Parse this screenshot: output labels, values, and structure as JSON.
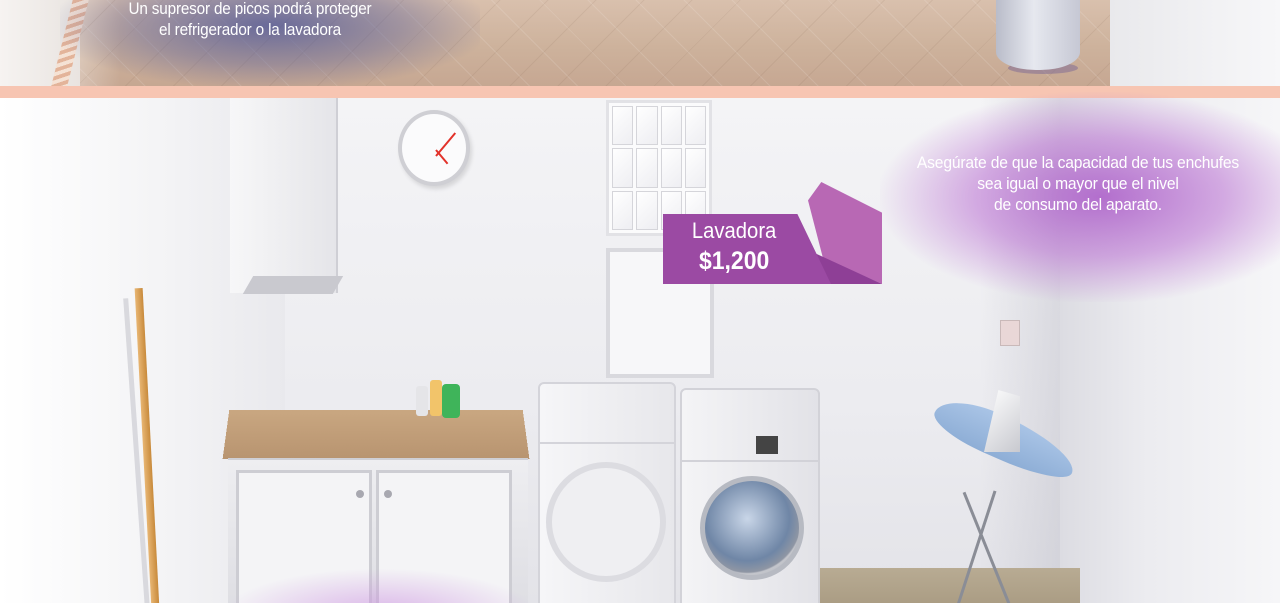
{
  "top_scene": {
    "caption_line1": "Un supresor de picos podrá proteger",
    "caption_line2": "el refrigerador o la lavadora"
  },
  "laundry_scene": {
    "tip_line1": "Asegúrate de que la capacidad de tus enchufes",
    "tip_line2": "sea igual o mayor que el nivel",
    "tip_line3": "de consumo del aparato.",
    "price_tag": {
      "appliance": "Lavadora",
      "price": "$1,200"
    }
  },
  "colors": {
    "divider": "#f7c5b2",
    "tag_fill": "#9b4aa3",
    "tag_accent": "#b868b4",
    "glow": "#aa5ac8"
  },
  "icons": [
    "clock-icon",
    "washing-machine-icon",
    "dryer-icon",
    "iron-icon",
    "ironing-board-icon",
    "outlet-icon"
  ]
}
